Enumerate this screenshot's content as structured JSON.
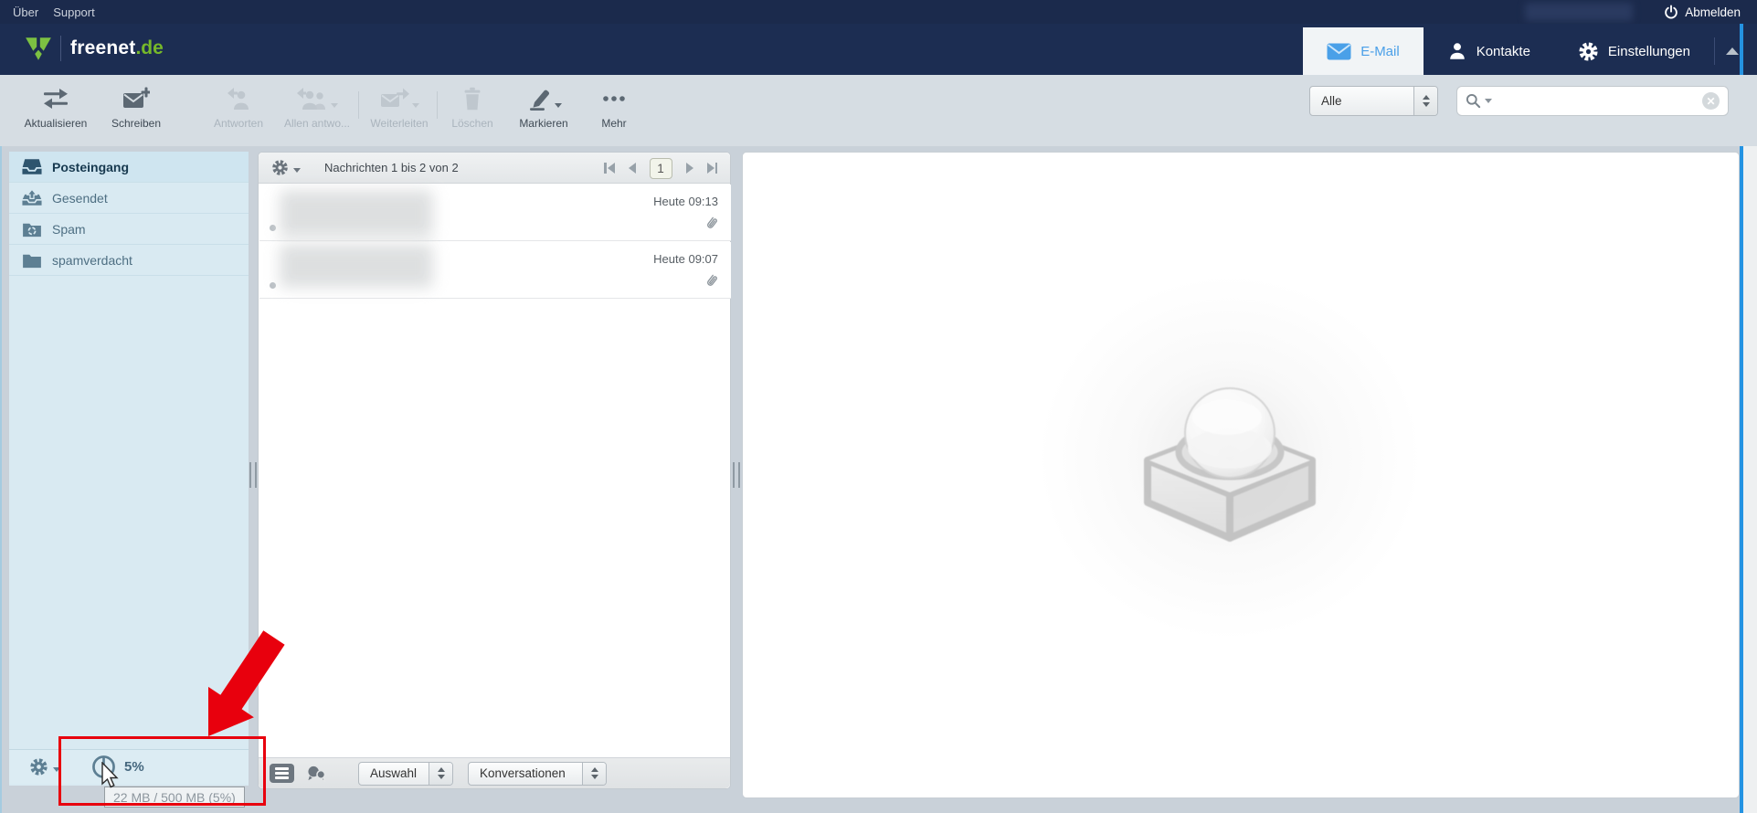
{
  "topbar": {
    "links": [
      {
        "label": "Über"
      },
      {
        "label": "Support"
      }
    ],
    "logout": {
      "label": "Abmelden",
      "icon": "power-icon"
    }
  },
  "header": {
    "brand": {
      "name": "freenet",
      "suffix": ".de",
      "icon": "freenet-logo"
    },
    "tabs": [
      {
        "label": "E-Mail",
        "icon": "mail-icon",
        "active": true
      },
      {
        "label": "Kontakte",
        "icon": "contacts-icon",
        "active": false
      },
      {
        "label": "Einstellungen",
        "icon": "gear-icon",
        "active": false
      }
    ]
  },
  "toolbar": {
    "buttons": [
      {
        "label": "Aktualisieren",
        "icon": "refresh-icon",
        "enabled": true,
        "caret": false
      },
      {
        "label": "Schreiben",
        "icon": "compose-icon",
        "enabled": true,
        "caret": false
      },
      {
        "label": "Antworten",
        "icon": "reply-icon",
        "enabled": false,
        "caret": false
      },
      {
        "label": "Allen antwo...",
        "icon": "reply-all-icon",
        "enabled": false,
        "caret": true
      },
      {
        "label": "Weiterleiten",
        "icon": "forward-icon",
        "enabled": false,
        "caret": true
      },
      {
        "label": "Löschen",
        "icon": "trash-icon",
        "enabled": false,
        "caret": false
      },
      {
        "label": "Markieren",
        "icon": "marker-icon",
        "enabled": true,
        "caret": true
      },
      {
        "label": "Mehr",
        "icon": "more-icon",
        "enabled": true,
        "caret": false
      }
    ],
    "filter": {
      "value": "Alle"
    },
    "search": {
      "placeholder": "",
      "icon": "search-icon"
    }
  },
  "sidebar": {
    "folders": [
      {
        "label": "Posteingang",
        "icon": "inbox-icon",
        "selected": true
      },
      {
        "label": "Gesendet",
        "icon": "sent-icon",
        "selected": false
      },
      {
        "label": "Spam",
        "icon": "spam-folder-icon",
        "selected": false
      },
      {
        "label": "spamverdacht",
        "icon": "folder-icon",
        "selected": false
      }
    ],
    "footer": {
      "quota_percent": "5%",
      "quota_tooltip": "22 MB / 500 MB (5%)"
    }
  },
  "message_list": {
    "header": {
      "title": "Nachrichten 1 bis 2 von 2",
      "page": "1"
    },
    "messages": [
      {
        "time": "Heute 09:13",
        "has_attachment": true
      },
      {
        "time": "Heute 09:07",
        "has_attachment": true
      }
    ],
    "footer": {
      "selection_label": "Auswahl",
      "view_label": "Konversationen"
    }
  },
  "colors": {
    "accent_blue": "#4a9fe8",
    "navy": "#1c2d52",
    "brand_green": "#76b82a",
    "annotation_red": "#e8000d",
    "folder_icon": "#5d7f93"
  }
}
